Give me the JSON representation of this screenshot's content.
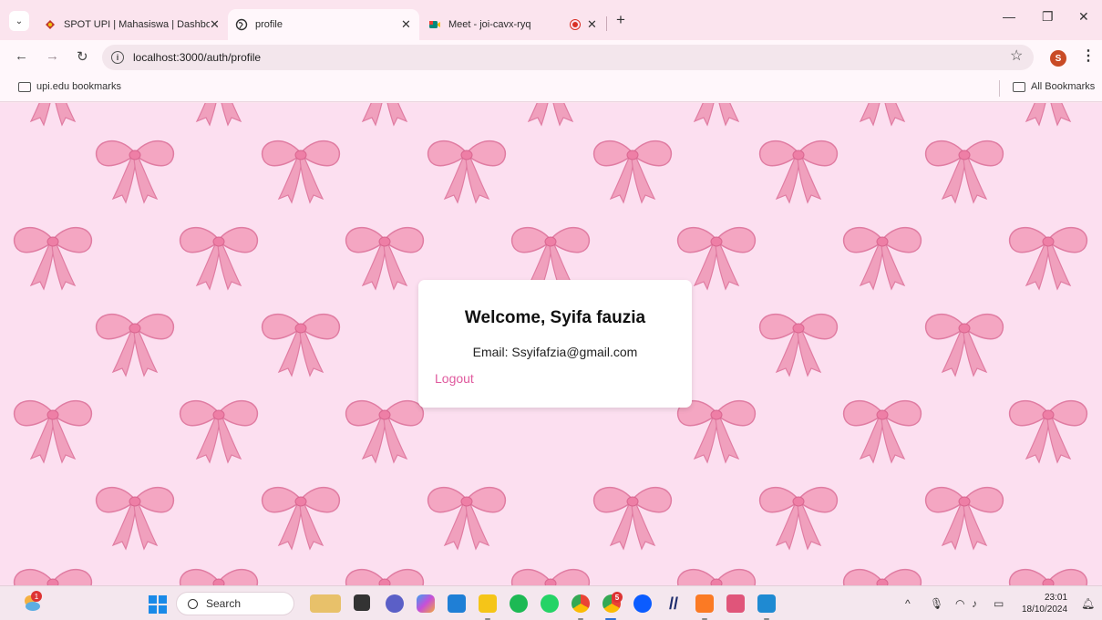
{
  "browser": {
    "tabs": [
      {
        "title": "SPOT UPI | Mahasiswa | Dashbo",
        "favicon": "upi-logo-icon",
        "active": false
      },
      {
        "title": "profile",
        "favicon": "globe-icon",
        "active": true
      },
      {
        "title": "Meet - joi-cavx-ryq",
        "favicon": "meet-icon",
        "active": false,
        "recording": true
      }
    ],
    "tab_close_glyph": "✕",
    "new_tab_glyph": "+",
    "url": "localhost:3000/auth/profile",
    "profile_initial": "S",
    "bookmarks": {
      "left": "upi.edu bookmarks",
      "right": "All Bookmarks"
    }
  },
  "profile_card": {
    "welcome": "Welcome, Syifa fauzia",
    "email": "Email: Ssyifafzia@gmail.com",
    "logout": "Logout"
  },
  "taskbar": {
    "search_label": "Search",
    "weather_badge": "1",
    "chrome_badge": "5",
    "time": "23:01",
    "date": "18/10/2024"
  },
  "colors": {
    "page_background": "#fcdff0",
    "bow": "#ee8fb0",
    "logout_link": "#e05a9e",
    "chrome_background": "#fbe4ee"
  }
}
